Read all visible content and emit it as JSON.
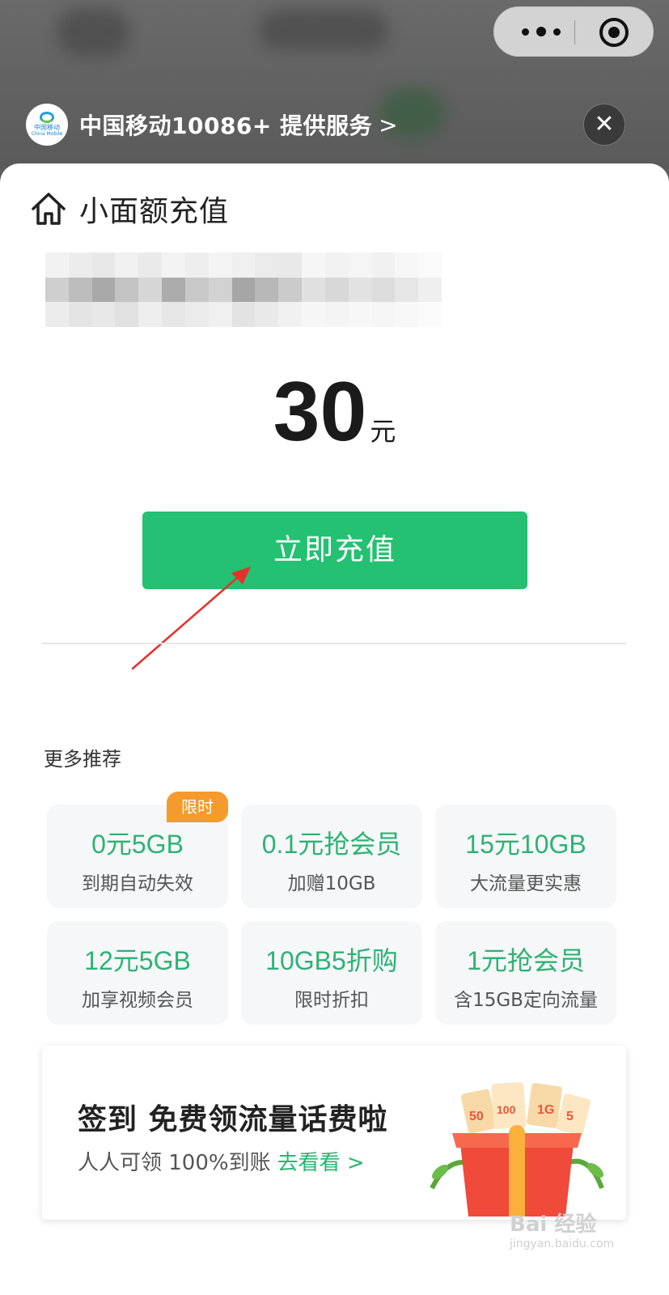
{
  "provider": {
    "name": "中国移动10086+ 提供服务",
    "arrow": ">",
    "logo_text_cn": "中国移动",
    "logo_text_en": "China Mobile"
  },
  "capsule": {
    "more_icon": "more-dots-icon",
    "close_icon": "target-icon"
  },
  "close": {
    "icon": "close-icon",
    "glyph": "✕"
  },
  "page": {
    "title": "小面额充值",
    "home_icon": "home-icon"
  },
  "amount": {
    "value": "30",
    "unit": "元"
  },
  "recharge_button": {
    "label": "立即充值",
    "color": "#23c171"
  },
  "recommend": {
    "title": "更多推荐",
    "cards": [
      {
        "main": "0元5GB",
        "sub": "到期自动失效",
        "badge": "限时"
      },
      {
        "main": "0.1元抢会员",
        "sub": "加赠10GB"
      },
      {
        "main": "15元10GB",
        "sub": "大流量更实惠"
      },
      {
        "main": "12元5GB",
        "sub": "加享视频会员"
      },
      {
        "main": "10GB5折购",
        "sub": "限时折扣"
      },
      {
        "main": "1元抢会员",
        "sub": "含15GB定向流量"
      }
    ],
    "accent": "#2db374"
  },
  "banner": {
    "headline": "签到 免费领流量话费啦",
    "desc": "人人可领 100%到账",
    "link": "去看看 >"
  },
  "watermark": {
    "text": "Bai 经验",
    "url": "jingyan.baidu.com"
  }
}
